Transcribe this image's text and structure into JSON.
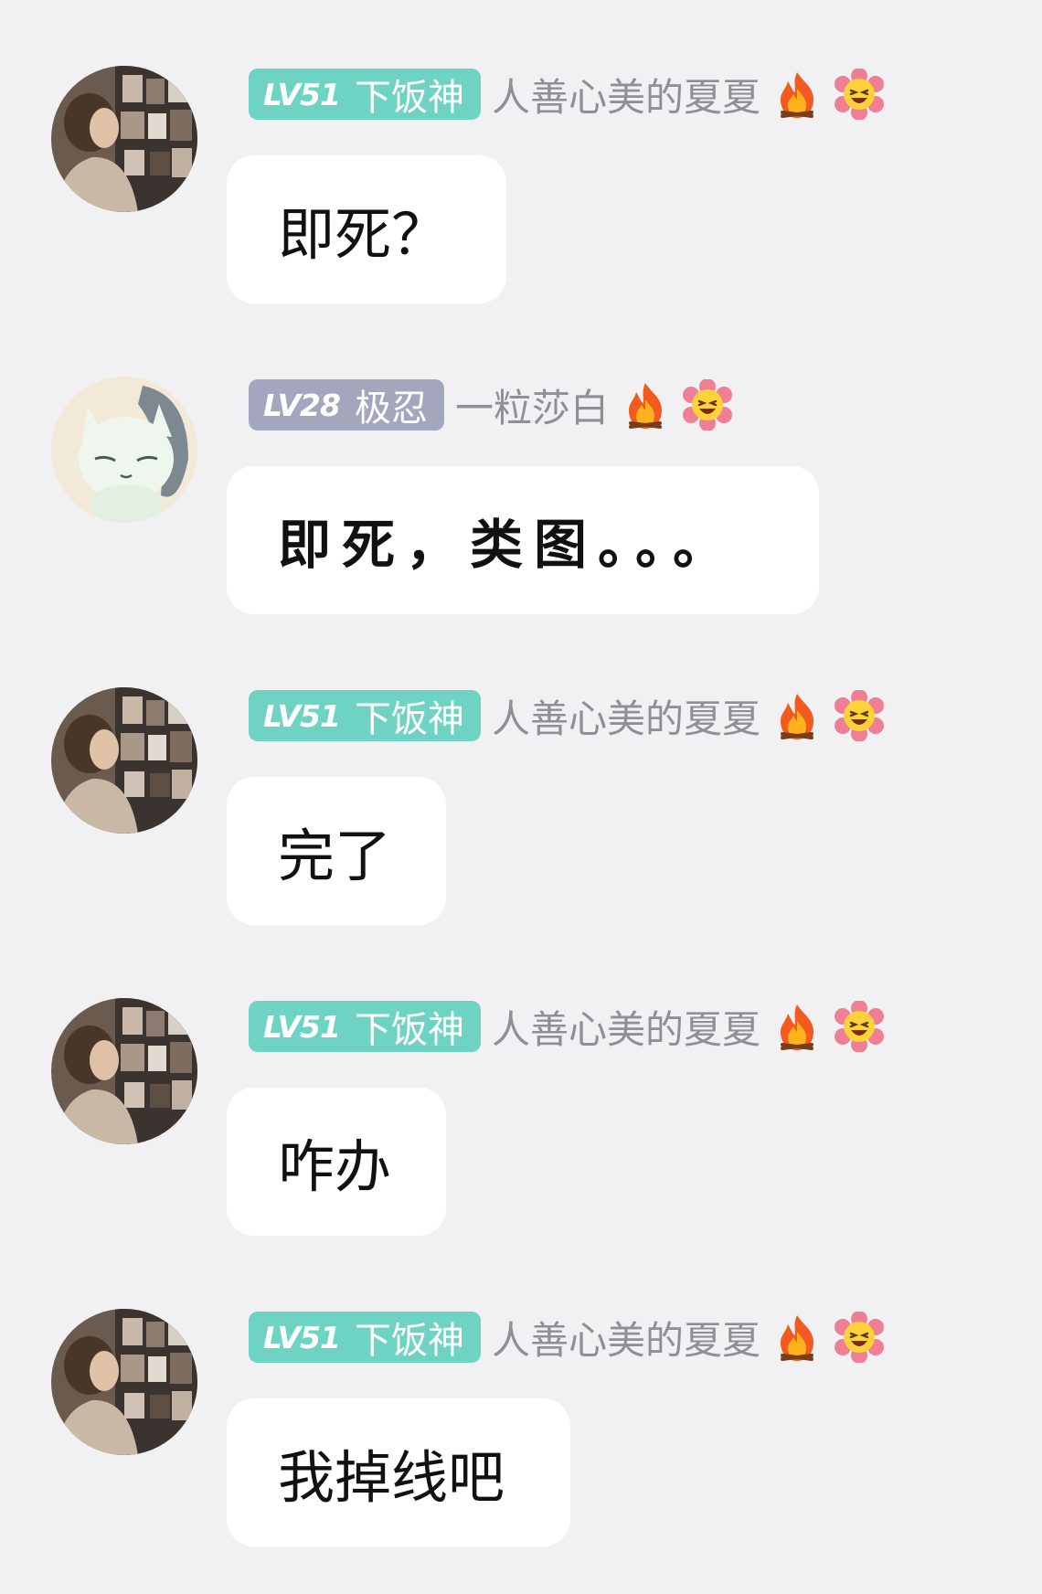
{
  "messages": [
    {
      "level": "LV51",
      "title": "下饭神",
      "badge_color": "#6fd3c3",
      "nickname": "人善心美的夏夏",
      "icons": [
        "fire-icon",
        "laughing-flower-icon"
      ],
      "text": "即死？",
      "avatar": "girl-bookshelf-avatar"
    },
    {
      "level": "LV28",
      "title": "极忍",
      "badge_color": "#a3a6bc",
      "nickname": "一粒莎白",
      "icons": [
        "fire-icon",
        "laughing-flower-icon"
      ],
      "text": "即死，类图。。。",
      "avatar": "white-cat-avatar"
    },
    {
      "level": "LV51",
      "title": "下饭神",
      "badge_color": "#6fd3c3",
      "nickname": "人善心美的夏夏",
      "icons": [
        "fire-icon",
        "laughing-flower-icon"
      ],
      "text": "完了",
      "avatar": "girl-bookshelf-avatar"
    },
    {
      "level": "LV51",
      "title": "下饭神",
      "badge_color": "#6fd3c3",
      "nickname": "人善心美的夏夏",
      "icons": [
        "fire-icon",
        "laughing-flower-icon"
      ],
      "text": "咋办",
      "avatar": "girl-bookshelf-avatar"
    },
    {
      "level": "LV51",
      "title": "下饭神",
      "badge_color": "#6fd3c3",
      "nickname": "人善心美的夏夏",
      "icons": [
        "fire-icon",
        "laughing-flower-icon"
      ],
      "text": "我掉线吧",
      "avatar": "girl-bookshelf-avatar"
    }
  ],
  "colors": {
    "background": "#f1f1f3",
    "bubble": "#ffffff",
    "nickname": "#8f8f94"
  }
}
